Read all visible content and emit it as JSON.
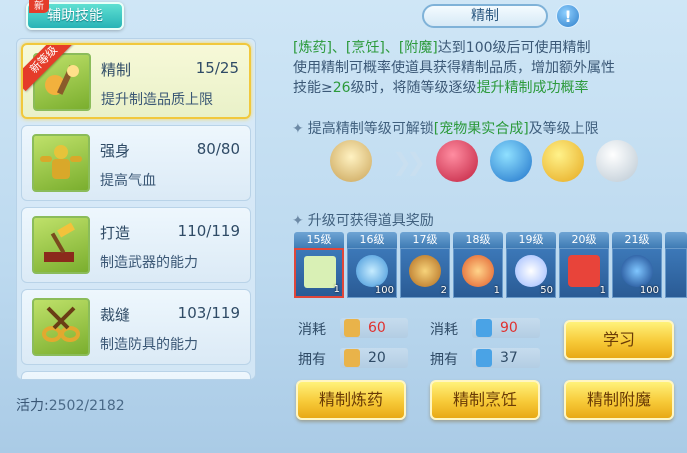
{
  "tab": {
    "label": "辅助技能",
    "badge": "新"
  },
  "skills": [
    {
      "name": "精制",
      "count": "15/25",
      "desc": "提升制造品质上限",
      "ribbon": "新等级"
    },
    {
      "name": "强身",
      "count": "80/80",
      "desc": "提高气血"
    },
    {
      "name": "打造",
      "count": "110/119",
      "desc": "制造武器的能力"
    },
    {
      "name": "裁缝",
      "count": "103/119",
      "desc": "制造防具的能力"
    }
  ],
  "energy": {
    "label": "活力:",
    "value": "2502/2182"
  },
  "header": {
    "title": "精制",
    "help": "!"
  },
  "description": {
    "line1_a": "[炼药]、[烹饪]、[附魔]",
    "line1_b": "达到100级后可使用精制",
    "line2": "使用精制可概率使道具获得精制品质，增加额外属性",
    "line3_a": "技能≥",
    "line3_num": "26",
    "line3_b": "级时，将随等级逐级",
    "line3_c": "提升精制成功概率"
  },
  "unlock": {
    "prefix": "提高精制等级可解锁",
    "highlight": "[宠物果实合成]",
    "suffix": "及等级上限"
  },
  "rewards": {
    "title": "升级可获得道具奖励",
    "items": [
      {
        "level": "15级",
        "qty": "1",
        "icon": "checkmark-scroll-icon"
      },
      {
        "level": "16级",
        "qty": "100",
        "icon": "swirl-orb-icon"
      },
      {
        "level": "17级",
        "qty": "2",
        "icon": "potion-flask-icon"
      },
      {
        "level": "18级",
        "qty": "1",
        "icon": "peach-fruit-icon"
      },
      {
        "level": "19级",
        "qty": "50",
        "icon": "crystal-star-icon"
      },
      {
        "level": "20级",
        "qty": "1",
        "icon": "gift-box-icon"
      },
      {
        "level": "21级",
        "qty": "100",
        "icon": "blue-orb-icon"
      }
    ]
  },
  "costs": {
    "consume_label": "消耗",
    "own_label": "拥有",
    "energy_consume": "60",
    "energy_own": "20",
    "item_consume": "90",
    "item_own": "37"
  },
  "buttons": {
    "learn": "学习",
    "alchemy": "精制炼药",
    "cooking": "精制烹饪",
    "enchant": "精制附魔"
  },
  "colors": {
    "accent_green": "#2c9a3b",
    "cost_red": "#e0312f",
    "button_gold": "#f7c938"
  }
}
